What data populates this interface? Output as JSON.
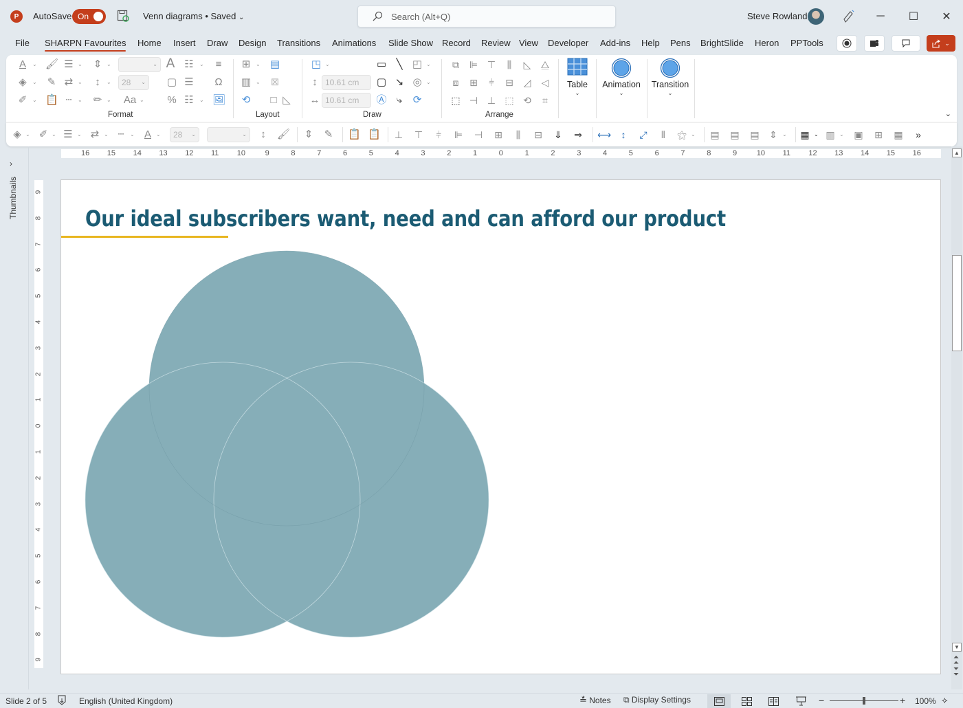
{
  "titlebar": {
    "app_logo": "P",
    "autosave_label": "AutoSave",
    "autosave_state": "On",
    "document_title": "Venn diagrams • Saved",
    "search_placeholder": "Search (Alt+Q)",
    "user_name": "Steve Rowland",
    "minimize": "─",
    "maximize": "☐",
    "close": "✕"
  },
  "tabs": [
    {
      "label": "File"
    },
    {
      "label": "SHARPN Favourites",
      "active": true
    },
    {
      "label": "Home"
    },
    {
      "label": "Insert"
    },
    {
      "label": "Draw"
    },
    {
      "label": "Design"
    },
    {
      "label": "Transitions"
    },
    {
      "label": "Animations"
    },
    {
      "label": "Slide Show"
    },
    {
      "label": "Record"
    },
    {
      "label": "Review"
    },
    {
      "label": "View"
    },
    {
      "label": "Developer"
    },
    {
      "label": "Add-ins"
    },
    {
      "label": "Help"
    },
    {
      "label": "Pens"
    },
    {
      "label": "BrightSlide"
    },
    {
      "label": "Heron"
    },
    {
      "label": "PPTools"
    }
  ],
  "ribbon": {
    "groups": {
      "format": "Format",
      "layout": "Layout",
      "draw": "Draw",
      "arrange": "Arrange"
    },
    "font_size_value": "28",
    "shape_height": "10.61 cm",
    "shape_width": "10.61 cm",
    "table_label": "Table",
    "animation_label": "Animation",
    "transition_label": "Transition",
    "case_label": "Aa"
  },
  "qat": {
    "font_size_value": "28"
  },
  "thumbnails_label": "Thumbnails",
  "rulers": {
    "horizontal": [
      "16",
      "15",
      "14",
      "13",
      "12",
      "11",
      "10",
      "9",
      "8",
      "7",
      "6",
      "5",
      "4",
      "3",
      "2",
      "1",
      "0",
      "1",
      "2",
      "3",
      "4",
      "5",
      "6",
      "7",
      "8",
      "9",
      "10",
      "11",
      "12",
      "13",
      "14",
      "15",
      "16"
    ],
    "vertical": [
      "9",
      "8",
      "7",
      "6",
      "5",
      "4",
      "3",
      "2",
      "1",
      "0",
      "1",
      "2",
      "3",
      "4",
      "5",
      "6",
      "7",
      "8",
      "9"
    ]
  },
  "slide": {
    "title": "Our ideal subscribers want, need and can afford our product",
    "title_color": "#1b5b73",
    "accent_color": "#e8b621",
    "venn_fill": "#86aeb8",
    "venn_circles": 3
  },
  "statusbar": {
    "slide_indicator": "Slide 2 of 5",
    "language": "English (United Kingdom)",
    "notes_label": "Notes",
    "display_settings_label": "Display Settings",
    "zoom_level": "100%",
    "zoom_fraction": 0.5
  },
  "colors": {
    "brand": "#c43e1c",
    "window_bg": "#e3e9ee"
  }
}
